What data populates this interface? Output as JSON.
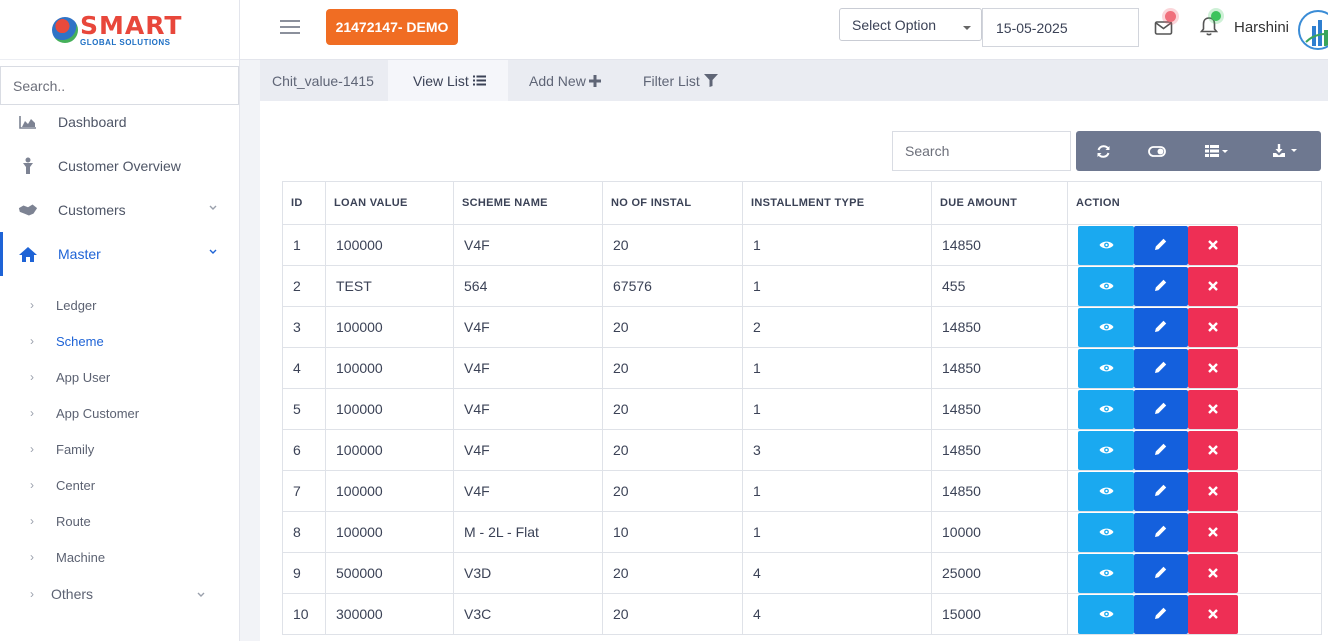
{
  "brand": {
    "logo_text": "SMART",
    "logo_sub": "GLOBAL SOLUTIONS"
  },
  "sidebar": {
    "search_placeholder": "Search..",
    "items": [
      {
        "label": "Dashboard",
        "icon": "chart-area-icon"
      },
      {
        "label": "Customer Overview",
        "icon": "person-icon"
      },
      {
        "label": "Customers",
        "icon": "handshake-icon",
        "expandable": true
      },
      {
        "label": "Master",
        "icon": "home-icon",
        "expandable": true,
        "active": true
      }
    ],
    "master_sub": [
      "Ledger",
      "Scheme",
      "App User",
      "App Customer",
      "Family",
      "Center",
      "Route",
      "Machine"
    ],
    "current_sub": "Scheme",
    "others_label": "Others"
  },
  "header": {
    "demo_label": "21472147- DEMO",
    "select_label": "Select Option",
    "date_value": "15-05-2025",
    "user_name": "Harshini",
    "colors": {
      "demo": "#f06d23",
      "mail_dot": "#f05a6a",
      "bell_dot": "#3cc35c"
    }
  },
  "tabs": [
    {
      "label": "Chit_value-1415"
    },
    {
      "label": "View List",
      "icon": "list-icon",
      "active": true
    },
    {
      "label": "Add New",
      "icon": "plus-icon"
    },
    {
      "label": "Filter List",
      "icon": "filter-icon"
    }
  ],
  "toolbar": {
    "search_placeholder": "Search",
    "buttons": [
      "refresh-icon",
      "toggle-icon",
      "columns-icon",
      "download-icon"
    ]
  },
  "table": {
    "columns": [
      "ID",
      "LOAN VALUE",
      "SCHEME NAME",
      "NO OF INSTAL",
      "INSTALLMENT TYPE",
      "DUE AMOUNT",
      "ACTION"
    ],
    "rows": [
      [
        "1",
        "100000",
        "V4F",
        "20",
        "1",
        "14850"
      ],
      [
        "2",
        "TEST",
        "564",
        "67576",
        "1",
        "455"
      ],
      [
        "3",
        "100000",
        "V4F",
        "20",
        "2",
        "14850"
      ],
      [
        "4",
        "100000",
        "V4F",
        "20",
        "1",
        "14850"
      ],
      [
        "5",
        "100000",
        "V4F",
        "20",
        "1",
        "14850"
      ],
      [
        "6",
        "100000",
        "V4F",
        "20",
        "3",
        "14850"
      ],
      [
        "7",
        "100000",
        "V4F",
        "20",
        "1",
        "14850"
      ],
      [
        "8",
        "100000",
        "M - 2L - Flat",
        "10",
        "1",
        "10000"
      ],
      [
        "9",
        "500000",
        "V3D",
        "20",
        "4",
        "25000"
      ],
      [
        "10",
        "300000",
        "V3C",
        "20",
        "4",
        "15000"
      ]
    ]
  }
}
